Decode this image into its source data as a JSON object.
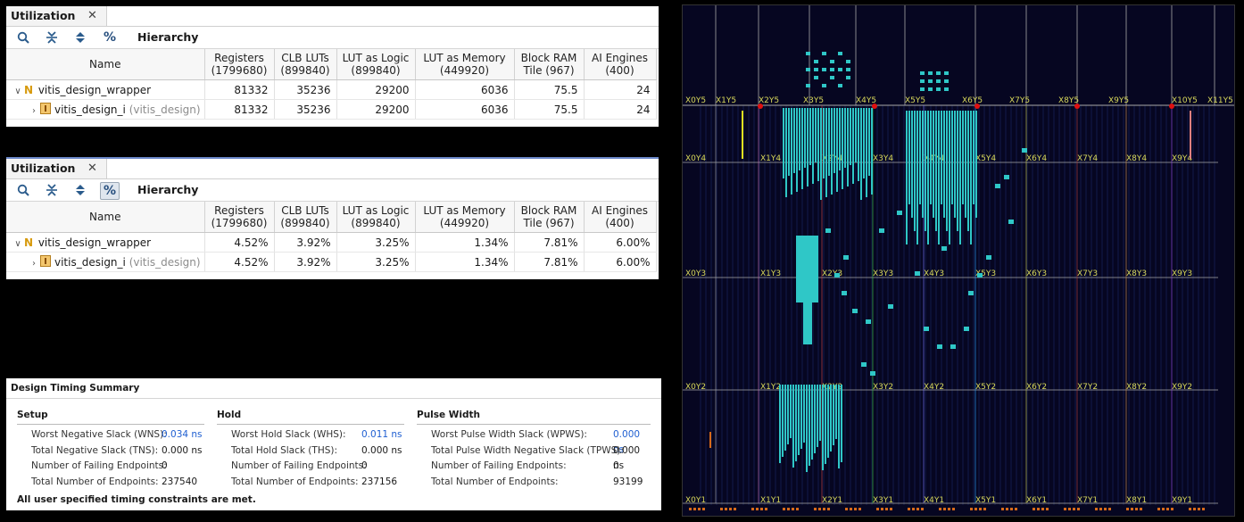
{
  "util1": {
    "tab": "Utilization",
    "toolbar_title": "Hierarchy",
    "columns": [
      "Name",
      "Registers\n(1799680)",
      "CLB LUTs\n(899840)",
      "LUT as Logic\n(899840)",
      "LUT as Memory\n(449920)",
      "Block RAM\nTile (967)",
      "AI Engines\n(400)"
    ],
    "rows": [
      {
        "name": "vitis_design_wrapper",
        "sub": "",
        "values": [
          "81332",
          "35236",
          "29200",
          "6036",
          "75.5",
          "24"
        ]
      },
      {
        "name": "vitis_design_i",
        "sub": "(vitis_design)",
        "values": [
          "81332",
          "35236",
          "29200",
          "6036",
          "75.5",
          "24"
        ]
      }
    ]
  },
  "util2": {
    "tab": "Utilization",
    "toolbar_title": "Hierarchy",
    "columns": [
      "Name",
      "Registers\n(1799680)",
      "CLB LUTs\n(899840)",
      "LUT as Logic\n(899840)",
      "LUT as Memory\n(449920)",
      "Block RAM\nTile (967)",
      "AI Engines\n(400)"
    ],
    "rows": [
      {
        "name": "vitis_design_wrapper",
        "sub": "",
        "values": [
          "4.52%",
          "3.92%",
          "3.25%",
          "1.34%",
          "7.81%",
          "6.00%"
        ]
      },
      {
        "name": "vitis_design_i",
        "sub": "(vitis_design)",
        "values": [
          "4.52%",
          "3.92%",
          "3.25%",
          "1.34%",
          "7.81%",
          "6.00%"
        ]
      }
    ]
  },
  "timing": {
    "title": "Design Timing Summary",
    "setup": {
      "header": "Setup",
      "rows": [
        {
          "label": "Worst Negative Slack (WNS):",
          "value": "0.034 ns",
          "link": true
        },
        {
          "label": "Total Negative Slack (TNS):",
          "value": "0.000 ns",
          "link": false
        },
        {
          "label": "Number of Failing Endpoints:",
          "value": "0",
          "link": false
        },
        {
          "label": "Total Number of Endpoints:",
          "value": "237540",
          "link": false
        }
      ]
    },
    "hold": {
      "header": "Hold",
      "rows": [
        {
          "label": "Worst Hold Slack (WHS):",
          "value": "0.011 ns",
          "link": true
        },
        {
          "label": "Total Hold Slack (THS):",
          "value": "0.000 ns",
          "link": false
        },
        {
          "label": "Number of Failing Endpoints:",
          "value": "0",
          "link": false
        },
        {
          "label": "Total Number of Endpoints:",
          "value": "237156",
          "link": false
        }
      ]
    },
    "pulse": {
      "header": "Pulse Width",
      "rows": [
        {
          "label": "Worst Pulse Width Slack (WPWS):",
          "value": "0.000 ns",
          "link": true
        },
        {
          "label": "Total Pulse Width Negative Slack (TPWS):",
          "value": "0.000 ns",
          "link": false
        },
        {
          "label": "Number of Failing Endpoints:",
          "value": "0",
          "link": false
        },
        {
          "label": "Total Number of Endpoints:",
          "value": "93199",
          "link": false
        }
      ]
    },
    "footer": "All user specified timing constraints are met."
  },
  "device": {
    "top_labels": [
      "X0Y5",
      "X1Y5",
      "X2Y5",
      "X3Y5",
      "X4Y5",
      "X5Y5",
      "X6Y5",
      "X7Y5",
      "X8Y5",
      "X9Y5",
      "X10Y5",
      "X11Y5"
    ],
    "rows": [
      {
        "labels": [
          "X0Y4",
          "X1Y4",
          "X2Y4",
          "X3Y4",
          "X4Y4",
          "X5Y4",
          "X6Y4",
          "X7Y4",
          "X8Y4",
          "X9Y4"
        ]
      },
      {
        "labels": [
          "X0Y3",
          "X1Y3",
          "X2Y3",
          "X3Y3",
          "X4Y3",
          "X5Y3",
          "X6Y3",
          "X7Y3",
          "X8Y3",
          "X9Y3"
        ]
      },
      {
        "labels": [
          "X0Y2",
          "X1Y2",
          "X2Y2",
          "X3Y2",
          "X4Y2",
          "X5Y2",
          "X6Y2",
          "X7Y2",
          "X8Y2",
          "X9Y2"
        ]
      },
      {
        "labels": [
          "X0Y1",
          "X1Y1",
          "X2Y1",
          "X3Y1",
          "X4Y1",
          "X5Y1",
          "X6Y1",
          "X7Y1",
          "X8Y1",
          "X9Y1"
        ]
      }
    ],
    "colors": {
      "background": "#060621",
      "cell": "#2fc7c7",
      "grid": "#a8a8a8",
      "marker": "#e01010"
    }
  }
}
